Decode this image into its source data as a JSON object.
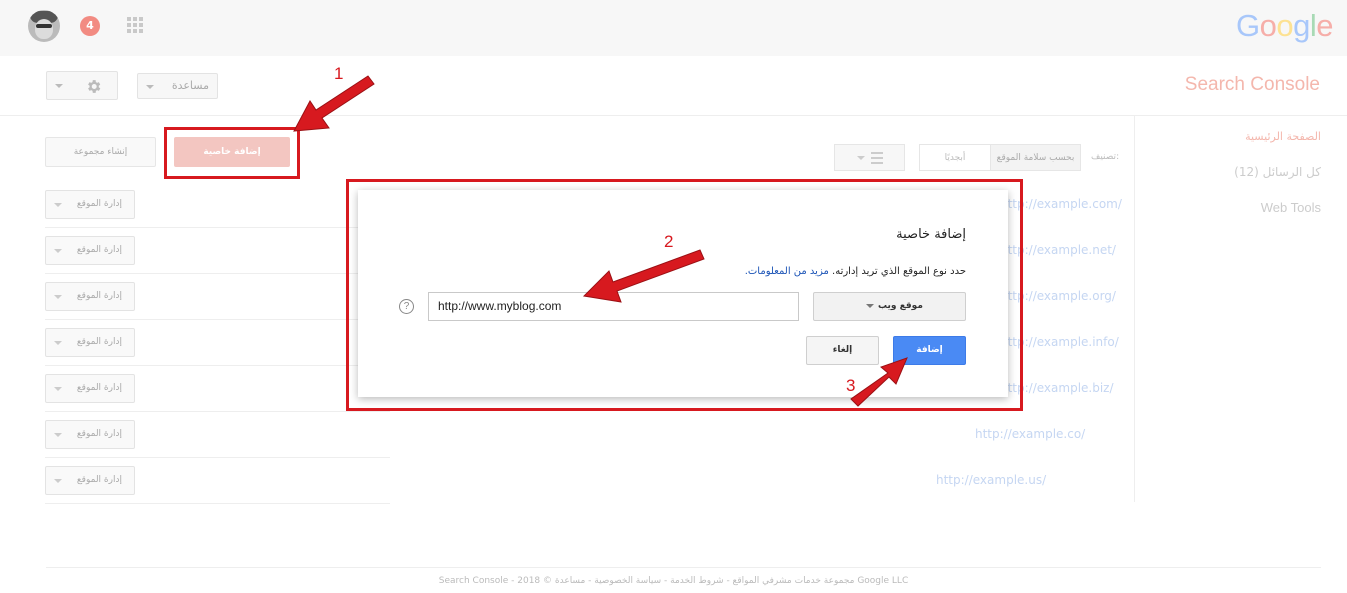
{
  "topbar": {
    "notification_count": "4",
    "logo_letters": [
      "G",
      "o",
      "o",
      "g",
      "l",
      "e"
    ],
    "logo_colors": [
      "#a8c7fa",
      "#f6aea9",
      "#fde293",
      "#a8c7fa",
      "#a8dab5",
      "#f6aea9"
    ]
  },
  "header": {
    "app_title": "Search Console",
    "help_label": "مساعدة"
  },
  "nav": {
    "home": "الصفحة الرئيسية",
    "messages": "كل الرسائل (12)",
    "web_tools": "Web Tools"
  },
  "toolbar": {
    "add_group_label": "إنشاء مجموعة",
    "add_property_label": "إضافة خاصية",
    "filter_label": "تصنيف:",
    "sort_by_health": "بحسب سلامة الموقع",
    "sort_alpha": "أبجديًا"
  },
  "sites": [
    {
      "manage_label": "إدارة الموقع",
      "url": "http://example.com/"
    },
    {
      "manage_label": "إدارة الموقع",
      "url": "http://example.net/"
    },
    {
      "manage_label": "إدارة الموقع",
      "url": "http://example.org/"
    },
    {
      "manage_label": "إدارة الموقع",
      "url": "http://example.info/"
    },
    {
      "manage_label": "إدارة الموقع",
      "url": "http://example.biz/"
    },
    {
      "manage_label": "إدارة الموقع",
      "url": "http://example.co/"
    },
    {
      "manage_label": "إدارة الموقع",
      "url": "http://example.us/"
    }
  ],
  "footer": {
    "text": "Search Console - مجموعة خدمات مشرفي المواقع - شروط الخدمة - سياسة الخصوصية - مساعدة © 2018 Google LLC"
  },
  "dialog": {
    "title": "إضافة خاصية",
    "subtitle": "حدد نوع الموقع الذي تريد إدارته.",
    "more_info_link": "مزيد من المعلومات.",
    "type_select_value": "موقع ويب",
    "url_input_value": "http://www.myblog.com",
    "help_glyph": "?",
    "cancel_label": "إلغاء",
    "add_label": "إضافة"
  },
  "annotations": {
    "step1": "1",
    "step2": "2",
    "step3": "3",
    "color": "#d7191f"
  }
}
